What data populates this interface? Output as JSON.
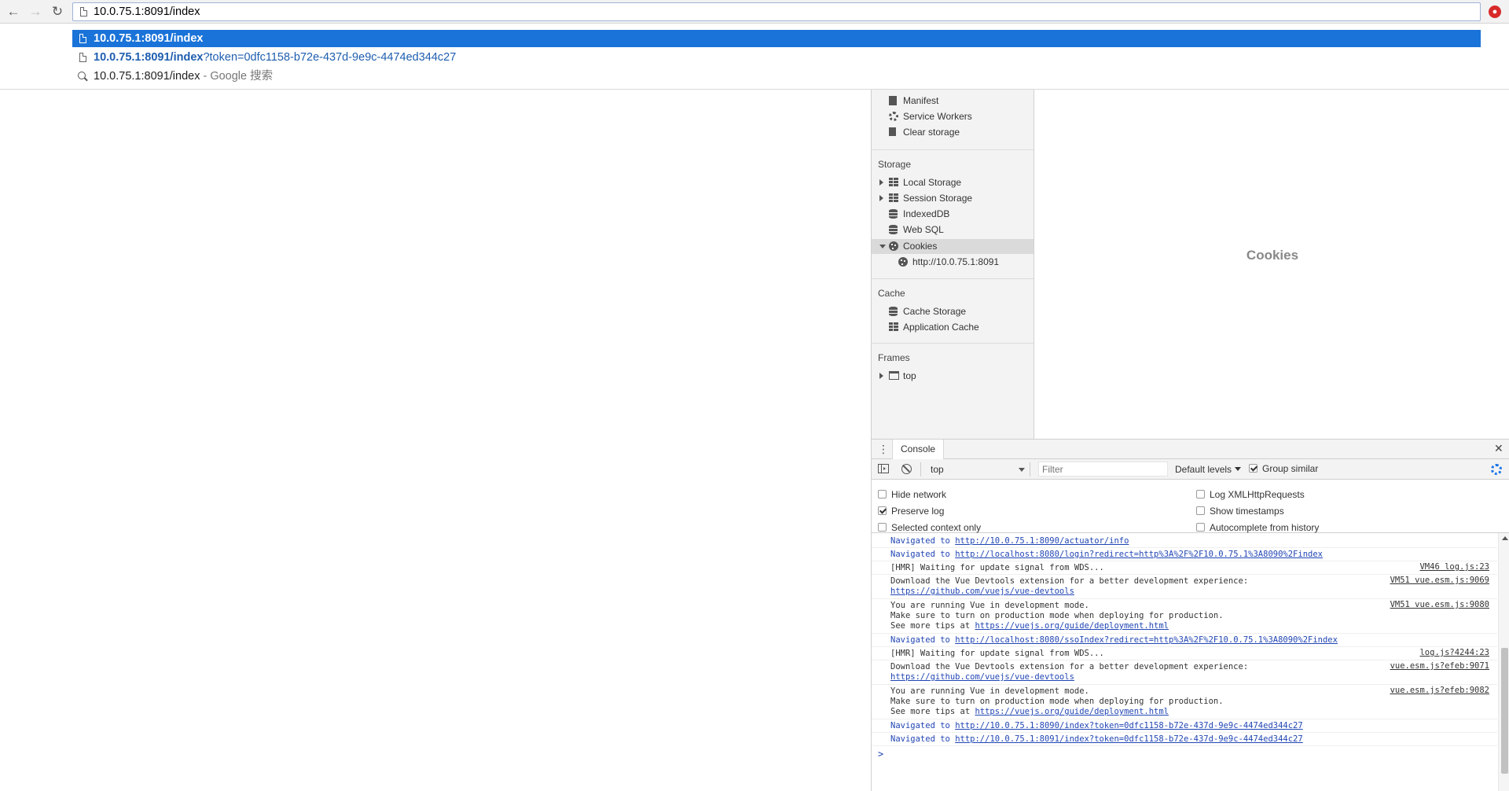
{
  "browser": {
    "url_value": "10.0.75.1:8091/index",
    "back_glyph": "←",
    "forward_glyph": "→",
    "reload_glyph": "↻",
    "extension_glyph": "●",
    "extension_color": "#d82a2a"
  },
  "autocomplete": {
    "s1": {
      "text": "10.0.75.1:8091/index"
    },
    "s2": {
      "bold": "10.0.75.1:8091/index",
      "rest": "?token=0dfc1158-b72e-437d-9e9c-4474ed344c27"
    },
    "s3": {
      "text": "10.0.75.1:8091/index",
      "suffix": " - Google 搜索"
    },
    "highlight_color": "#1a73d8"
  },
  "sidebar": {
    "app_items": [
      "Manifest",
      "Service Workers",
      "Clear storage"
    ],
    "storage_heading": "Storage",
    "storage_items": [
      "Local Storage",
      "Session Storage",
      "IndexedDB",
      "Web SQL",
      "Cookies"
    ],
    "cookie_origin": "http://10.0.75.1:8091",
    "cache_heading": "Cache",
    "cache_items": [
      "Cache Storage",
      "Application Cache"
    ],
    "frames_heading": "Frames",
    "frames_items": [
      "top"
    ]
  },
  "main_pane": {
    "title": "Cookies"
  },
  "drawer": {
    "menu_glyph": "⋮",
    "tab_label": "Console",
    "close_glyph": "✕"
  },
  "toolbar": {
    "context": "top",
    "filter_placeholder": "Filter",
    "levels": "Default levels",
    "group_similar": "Group similar",
    "group_similar_checked": true
  },
  "options": {
    "hide_network": "Hide network",
    "preserve_log": "Preserve log",
    "selected_context": "Selected context only",
    "log_xhr": "Log XMLHttpRequests",
    "show_timestamps": "Show timestamps",
    "autocomplete_history": "Autocomplete from history"
  },
  "console": {
    "messages": [
      {
        "kind": "nav",
        "prefix": "Navigated to ",
        "link": "http://10.0.75.1:8090/actuator/info"
      },
      {
        "kind": "nav",
        "prefix": "Navigated to ",
        "link": "http://localhost:8080/login?redirect=http%3A%2F%2F10.0.75.1%3A8090%2Findex"
      },
      {
        "kind": "log",
        "lines": [
          "[HMR] Waiting for update signal from WDS..."
        ],
        "source": "VM46 log.js:23"
      },
      {
        "kind": "log",
        "lines": [
          "Download the Vue Devtools extension for a better development experience:"
        ],
        "link_line": "https://github.com/vuejs/vue-devtools",
        "source": "VM51 vue.esm.js:9069"
      },
      {
        "kind": "log",
        "lines": [
          "You are running Vue in development mode.",
          "Make sure to turn on production mode when deploying for production."
        ],
        "tips_prefix": "See more tips at ",
        "link_line": "https://vuejs.org/guide/deployment.html",
        "source": "VM51 vue.esm.js:9080"
      },
      {
        "kind": "nav",
        "prefix": "Navigated to ",
        "link": "http://localhost:8080/ssoIndex?redirect=http%3A%2F%2F10.0.75.1%3A8090%2Findex"
      },
      {
        "kind": "log",
        "lines": [
          "[HMR] Waiting for update signal from WDS..."
        ],
        "source": "log.js?4244:23"
      },
      {
        "kind": "log",
        "lines": [
          "Download the Vue Devtools extension for a better development experience:"
        ],
        "link_line": "https://github.com/vuejs/vue-devtools",
        "source": "vue.esm.js?efeb:9071"
      },
      {
        "kind": "log",
        "lines": [
          "You are running Vue in development mode.",
          "Make sure to turn on production mode when deploying for production."
        ],
        "tips_prefix": "See more tips at ",
        "link_line": "https://vuejs.org/guide/deployment.html",
        "source": "vue.esm.js?efeb:9082"
      },
      {
        "kind": "nav",
        "prefix": "Navigated to ",
        "link": "http://10.0.75.1:8090/index?token=0dfc1158-b72e-437d-9e9c-4474ed344c27"
      },
      {
        "kind": "nav",
        "prefix": "Navigated to ",
        "link": "http://10.0.75.1:8091/index?token=0dfc1158-b72e-437d-9e9c-4474ed344c27"
      }
    ],
    "prompt_glyph": ">"
  }
}
